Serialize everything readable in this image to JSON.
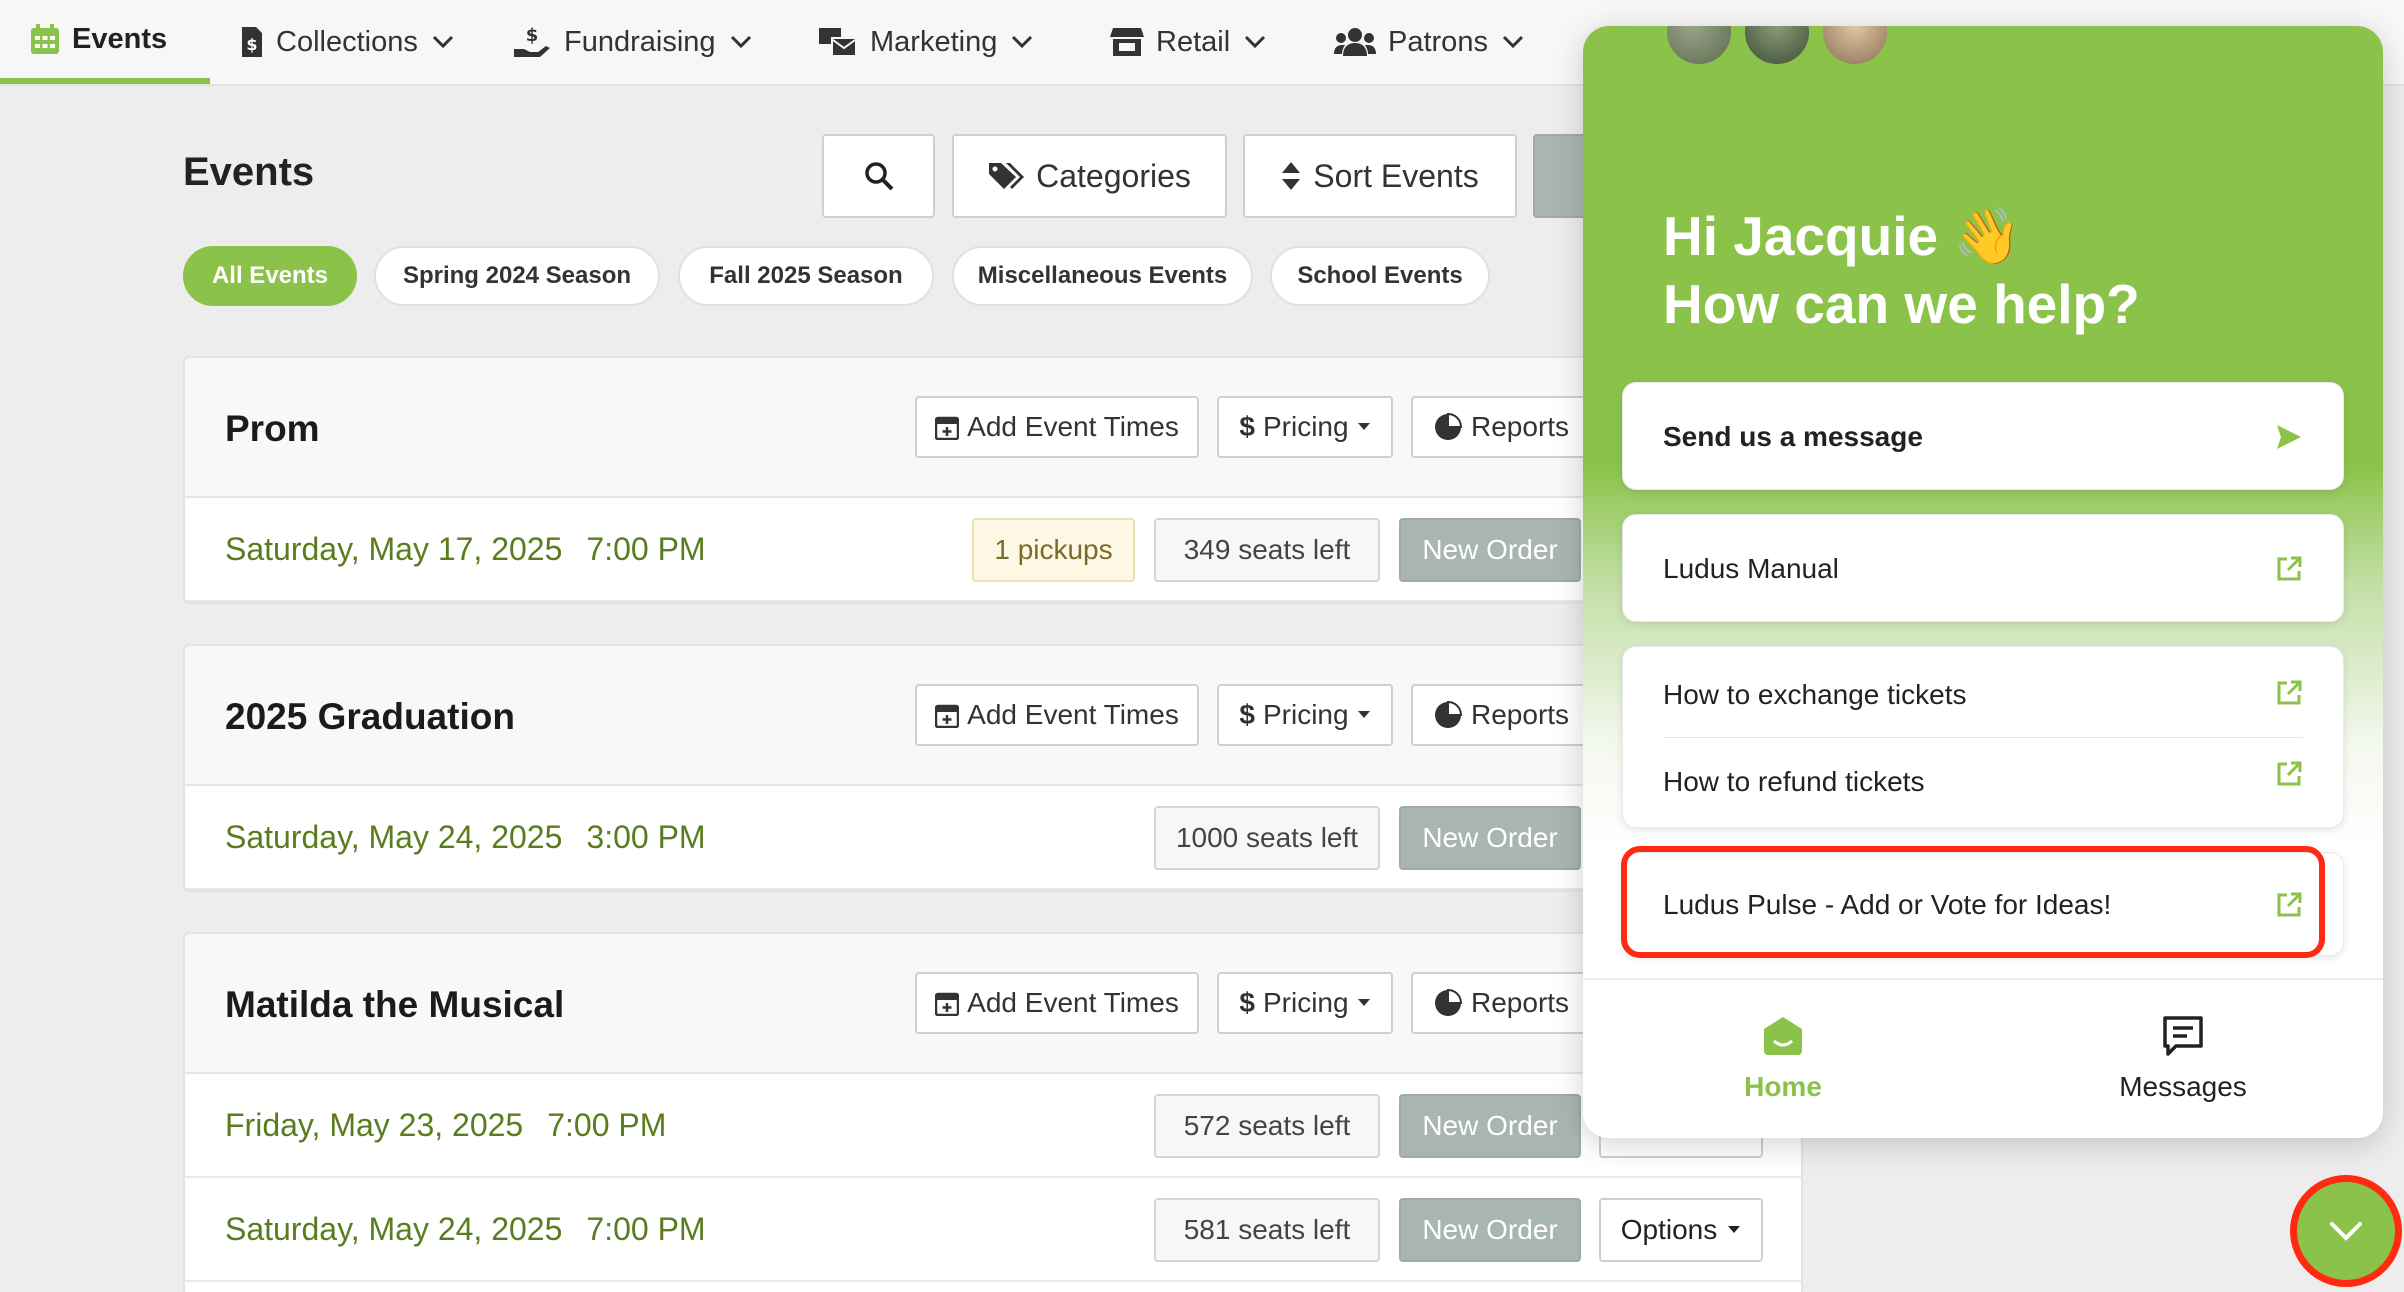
{
  "nav": {
    "items": [
      {
        "label": "Events",
        "icon": "calendar-icon",
        "active": true
      },
      {
        "label": "Collections",
        "icon": "receipt-icon"
      },
      {
        "label": "Fundraising",
        "icon": "hand-donate-icon"
      },
      {
        "label": "Marketing",
        "icon": "mail-bulk-icon"
      },
      {
        "label": "Retail",
        "icon": "store-icon"
      },
      {
        "label": "Patrons",
        "icon": "users-icon"
      }
    ]
  },
  "page": {
    "title": "Events",
    "toolbar": {
      "categories": "Categories",
      "sort": "Sort Events"
    },
    "filters": [
      "All Events",
      "Spring 2024 Season",
      "Fall 2025 Season",
      "Miscellaneous Events",
      "School Events"
    ]
  },
  "event_actions": {
    "add_times": "Add Event Times",
    "pricing": "Pricing",
    "reports": "Reports"
  },
  "events": [
    {
      "title": "Prom",
      "dates": [
        {
          "date": "Saturday, May 17, 2025",
          "time": "7:00 PM",
          "pickups": "1 pickups",
          "seats": "349 seats left",
          "new_order": "New Order"
        }
      ]
    },
    {
      "title": "2025 Graduation",
      "dates": [
        {
          "date": "Saturday, May 24, 2025",
          "time": "3:00 PM",
          "seats": "1000 seats left",
          "new_order": "New Order"
        }
      ]
    },
    {
      "title": "Matilda the Musical",
      "dates": [
        {
          "date": "Friday, May 23, 2025",
          "time": "7:00 PM",
          "seats": "572 seats left",
          "new_order": "New Order"
        },
        {
          "date": "Saturday, May 24, 2025",
          "time": "7:00 PM",
          "seats": "581 seats left",
          "new_order": "New Order",
          "options": "Options"
        }
      ]
    }
  ],
  "messenger": {
    "greeting_line1": "Hi Jacquie 👋",
    "greeting_line2": "How can we help?",
    "send_message": "Send us a message",
    "manual": "Ludus Manual",
    "articles": [
      "How to exchange tickets",
      "How to refund tickets"
    ],
    "pulse": "Ludus Pulse - Add or Vote for Ideas!",
    "tabs": {
      "home": "Home",
      "messages": "Messages"
    }
  },
  "colors": {
    "brand_green": "#8bc34a",
    "date_green": "#587c1e",
    "highlight_red": "#ff2a12"
  }
}
